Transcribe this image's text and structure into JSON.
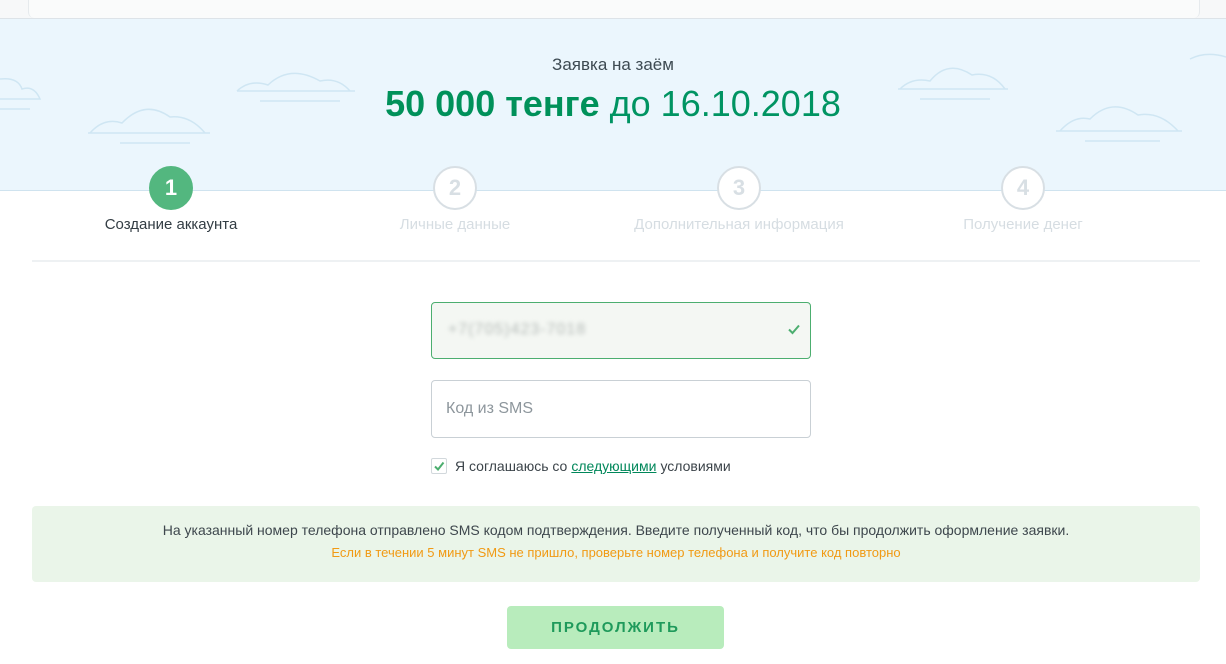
{
  "hero": {
    "subtitle": "Заявка на заём",
    "amount": "50 000 тенге",
    "date": "до 16.10.2018"
  },
  "steps": [
    {
      "number": "1",
      "label": "Создание аккаунта",
      "state": "active"
    },
    {
      "number": "2",
      "label": "Личные данные",
      "state": "inactive"
    },
    {
      "number": "3",
      "label": "Дополнительная информация",
      "state": "inactive"
    },
    {
      "number": "4",
      "label": "Получение денег",
      "state": "inactive"
    }
  ],
  "form": {
    "phone_value": "+7(705)423-7018",
    "phone_valid_icon": "check-icon",
    "sms_placeholder": "Код из SMS",
    "agree_checked": true,
    "agree_prefix": "Я соглашаюсь со",
    "agree_link": "следующими",
    "agree_suffix": "условиями"
  },
  "notice": {
    "text": "На указанный номер телефона отправлено SMS кодом подтверждения. Введите полученный код, что бы продолжить оформление заявки.",
    "warning": "Если в течении 5 минут SMS не пришло, проверьте номер телефона и получите код повторно"
  },
  "actions": {
    "continue_label": "ПРОДОЛЖИТЬ"
  },
  "colors": {
    "brand_green": "#00915a",
    "active_step": "#53b77f",
    "warning_orange": "#f19a14",
    "hero_bg": "#ebf6fd"
  }
}
